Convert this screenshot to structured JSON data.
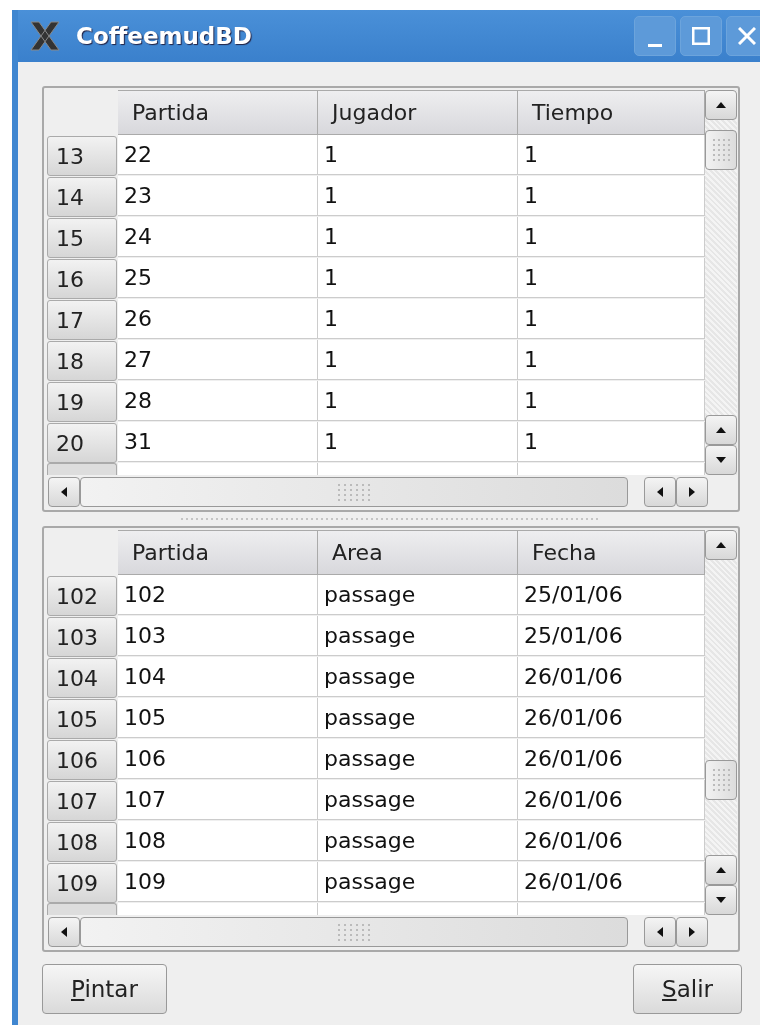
{
  "window": {
    "title": "CoffeemudBD"
  },
  "tables": [
    {
      "columns": [
        "Partida",
        "Jugador",
        "Tiempo"
      ],
      "rows": [
        {
          "header": "13",
          "cells": [
            "22",
            "1",
            "1"
          ]
        },
        {
          "header": "14",
          "cells": [
            "23",
            "1",
            "1"
          ]
        },
        {
          "header": "15",
          "cells": [
            "24",
            "1",
            "1"
          ]
        },
        {
          "header": "16",
          "cells": [
            "25",
            "1",
            "1"
          ]
        },
        {
          "header": "17",
          "cells": [
            "26",
            "1",
            "1"
          ]
        },
        {
          "header": "18",
          "cells": [
            "27",
            "1",
            "1"
          ]
        },
        {
          "header": "19",
          "cells": [
            "28",
            "1",
            "1"
          ]
        },
        {
          "header": "20",
          "cells": [
            "31",
            "1",
            "1"
          ]
        }
      ]
    },
    {
      "columns": [
        "Partida",
        "Area",
        "Fecha"
      ],
      "rows": [
        {
          "header": "102",
          "cells": [
            "102",
            "passage",
            "25/01/06"
          ]
        },
        {
          "header": "103",
          "cells": [
            "103",
            "passage",
            "25/01/06"
          ]
        },
        {
          "header": "104",
          "cells": [
            "104",
            "passage",
            "26/01/06"
          ]
        },
        {
          "header": "105",
          "cells": [
            "105",
            "passage",
            "26/01/06"
          ]
        },
        {
          "header": "106",
          "cells": [
            "106",
            "passage",
            "26/01/06"
          ]
        },
        {
          "header": "107",
          "cells": [
            "107",
            "passage",
            "26/01/06"
          ]
        },
        {
          "header": "108",
          "cells": [
            "108",
            "passage",
            "26/01/06"
          ]
        },
        {
          "header": "109",
          "cells": [
            "109",
            "passage",
            "26/01/06"
          ]
        }
      ]
    }
  ],
  "buttons": [
    {
      "label": "Pintar",
      "mnemonic_underlined": true
    },
    {
      "label": "Salir",
      "mnemonic_underlined": true
    }
  ]
}
